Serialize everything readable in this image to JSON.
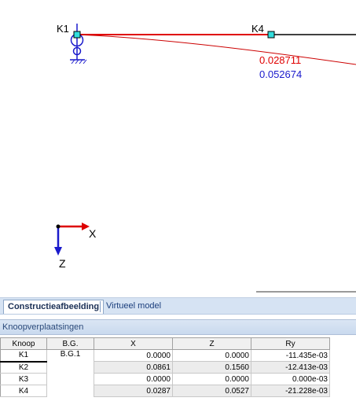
{
  "viewport": {
    "nodes": [
      {
        "label": "K1"
      },
      {
        "label": "K4"
      }
    ],
    "displacement_red": "0.028711",
    "displacement_blue": "0.052674",
    "axes": {
      "x_label": "X",
      "z_label": "Z"
    },
    "colors": {
      "beam": "#e00000",
      "deformed": "#cc0000",
      "support": "#1a1acc",
      "node": "#33dddd",
      "x_axis": "#dd0000",
      "z_axis": "#1a1acc"
    }
  },
  "tabs": {
    "active": "Constructieafbeelding",
    "inactive": "Virtueel model"
  },
  "panel": {
    "title": "Knoopverplaatsingen"
  },
  "table": {
    "headers": [
      "Knoop",
      "B.G.",
      "X",
      "Z",
      "Ry"
    ],
    "group": "B.G.1",
    "rows": [
      {
        "knoop": "K1",
        "x": "0.0000",
        "z": "0.0000",
        "ry": "-11.435e-03"
      },
      {
        "knoop": "K2",
        "x": "0.0861",
        "z": "0.1560",
        "ry": "-12.413e-03"
      },
      {
        "knoop": "K3",
        "x": "0.0000",
        "z": "0.0000",
        "ry": "0.000e-03"
      },
      {
        "knoop": "K4",
        "x": "0.0287",
        "z": "0.0527",
        "ry": "-21.228e-03"
      }
    ]
  }
}
